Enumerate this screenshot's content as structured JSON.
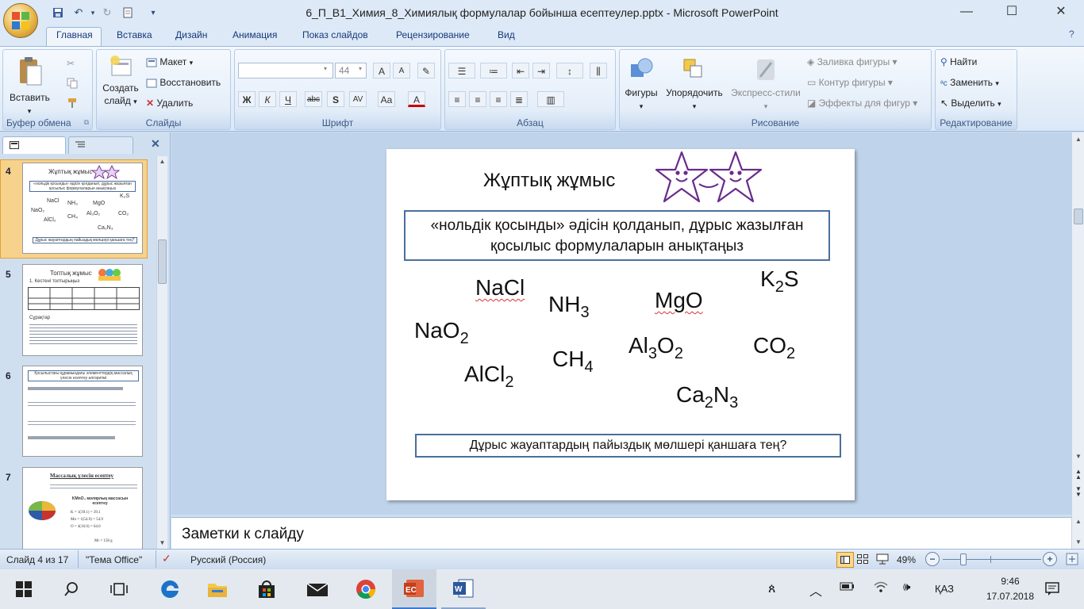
{
  "window": {
    "title": "6_П_В1_Химия_8_Химиялық формулалар бойынша есептеулер.pptx - Microsoft PowerPoint",
    "minimize": "—",
    "maximize": "☐",
    "close": "✕"
  },
  "ribbon_tabs": [
    "Главная",
    "Вставка",
    "Дизайн",
    "Анимация",
    "Показ слайдов",
    "Рецензирование",
    "Вид"
  ],
  "clipboard": {
    "paste": "Вставить",
    "label": "Буфер обмена"
  },
  "slides_group": {
    "new_slide_1": "Создать",
    "new_slide_2": "слайд",
    "layout": "Макет",
    "reset": "Восстановить",
    "delete": "Удалить",
    "label": "Слайды"
  },
  "font_group": {
    "font_name": "",
    "font_size": "44",
    "bold": "Ж",
    "italic": "К",
    "underline": "Ч",
    "strike": "abc",
    "shadow": "S",
    "spacing": "AV",
    "case": "Aa",
    "color": "A",
    "grow": "A",
    "shrink": "A",
    "label": "Шрифт"
  },
  "paragraph_group": {
    "label": "Абзац"
  },
  "drawing_group": {
    "shapes": "Фигуры",
    "arrange": "Упорядочить",
    "quick_styles": "Экспресс-стили",
    "fill": "Заливка фигуры",
    "outline": "Контур фигуры",
    "effects": "Эффекты для фигур",
    "label": "Рисование"
  },
  "editing_group": {
    "find": "Найти",
    "replace": "Заменить",
    "select": "Выделить",
    "label": "Редактирование"
  },
  "thumbnails": [
    {
      "num": "4",
      "title": "Жұптық жұмыс",
      "box1": "«нольдік қосынды» әдісін қолданып, дұрыс жазылған қосылыс формулаларын анықтаңыз",
      "box2": "Дұрыс жауаптардың пайыздық мөлшері қаншаға тең?"
    },
    {
      "num": "5",
      "title": "Топтық жұмыс",
      "sub": "1. Кестені толтырыңыз",
      "q": "Сұрақтар"
    },
    {
      "num": "6",
      "title": "Қосылыстағы құрамындағы элементтердің массалық үлесін есептеу алгоритмі"
    },
    {
      "num": "7",
      "title": "Массалық үлесін есептеу",
      "sub": "KMnO₄ молярлық массасын есептеу",
      "mr": "Mr = 158 g"
    }
  ],
  "slide": {
    "title": "Жұптық жұмыс",
    "instruction": "«нольдік қосынды» әдісін қолданып, дұрыс жазылған қосылыс формулаларын анықтаңыз",
    "question": "Дұрыс жауаптардың пайыздық мөлшері қаншаға тең?",
    "formulas": {
      "nacl": "NaCl",
      "nh3_base": "NH",
      "nh3_sub": "3",
      "mgo": "MgO",
      "k2s_a": "K",
      "k2s_sub": "2",
      "k2s_b": "S",
      "nao2_base": "NaO",
      "nao2_sub": "2",
      "ch4_base": "CH",
      "ch4_sub": "4",
      "al3o2_a": "Al",
      "al3o2_sub1": "3",
      "al3o2_b": "O",
      "al3o2_sub2": "2",
      "co2_base": "CO",
      "co2_sub": "2",
      "alcl2_base": "AlCl",
      "alcl2_sub": "2",
      "ca2n3_a": "Ca",
      "ca2n3_sub1": "2",
      "ca2n3_b": "N",
      "ca2n3_sub2": "3"
    }
  },
  "notes": "Заметки к слайду",
  "status": {
    "slide": "Слайд 4 из 17",
    "theme": "\"Тема Office\"",
    "lang": "Русский (Россия)",
    "zoom": "49%"
  },
  "taskbar": {
    "lang": "ҚАЗ",
    "time": "9:46",
    "date": "17.07.2018"
  }
}
